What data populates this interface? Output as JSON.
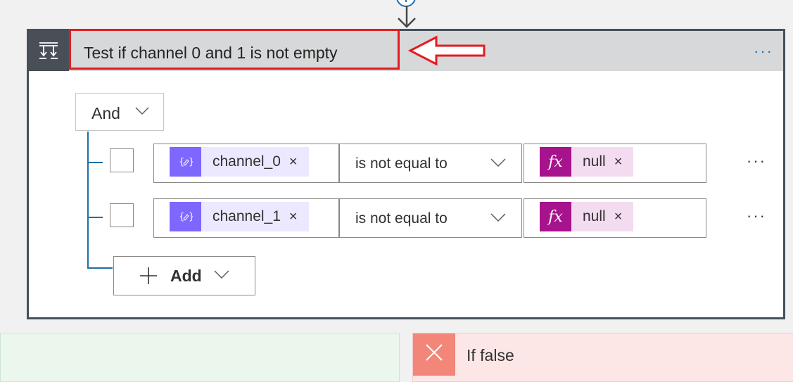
{
  "condition_card": {
    "title": "Test if channel 0 and 1 is not empty",
    "more_label": "···",
    "group_operator": "And",
    "rows": [
      {
        "left_token": "channel_0",
        "remove": "×",
        "operator": "is not equal to",
        "right_token": "null",
        "right_remove": "×",
        "more": "···"
      },
      {
        "left_token": "channel_1",
        "remove": "×",
        "operator": "is not equal to",
        "right_token": "null",
        "right_remove": "×",
        "more": "···"
      }
    ],
    "add_label": "Add"
  },
  "branches": {
    "false_label": "If false"
  },
  "colors": {
    "accent": "#1f6fbf",
    "variable_token": "#7e67ff",
    "expression_token": "#a7128d",
    "highlight_red": "#e31c23",
    "false_branch": "#f28779"
  },
  "icons": {
    "card": "condition-icon",
    "variable": "variable-icon",
    "expression": "fx-icon",
    "false": "close-icon"
  }
}
